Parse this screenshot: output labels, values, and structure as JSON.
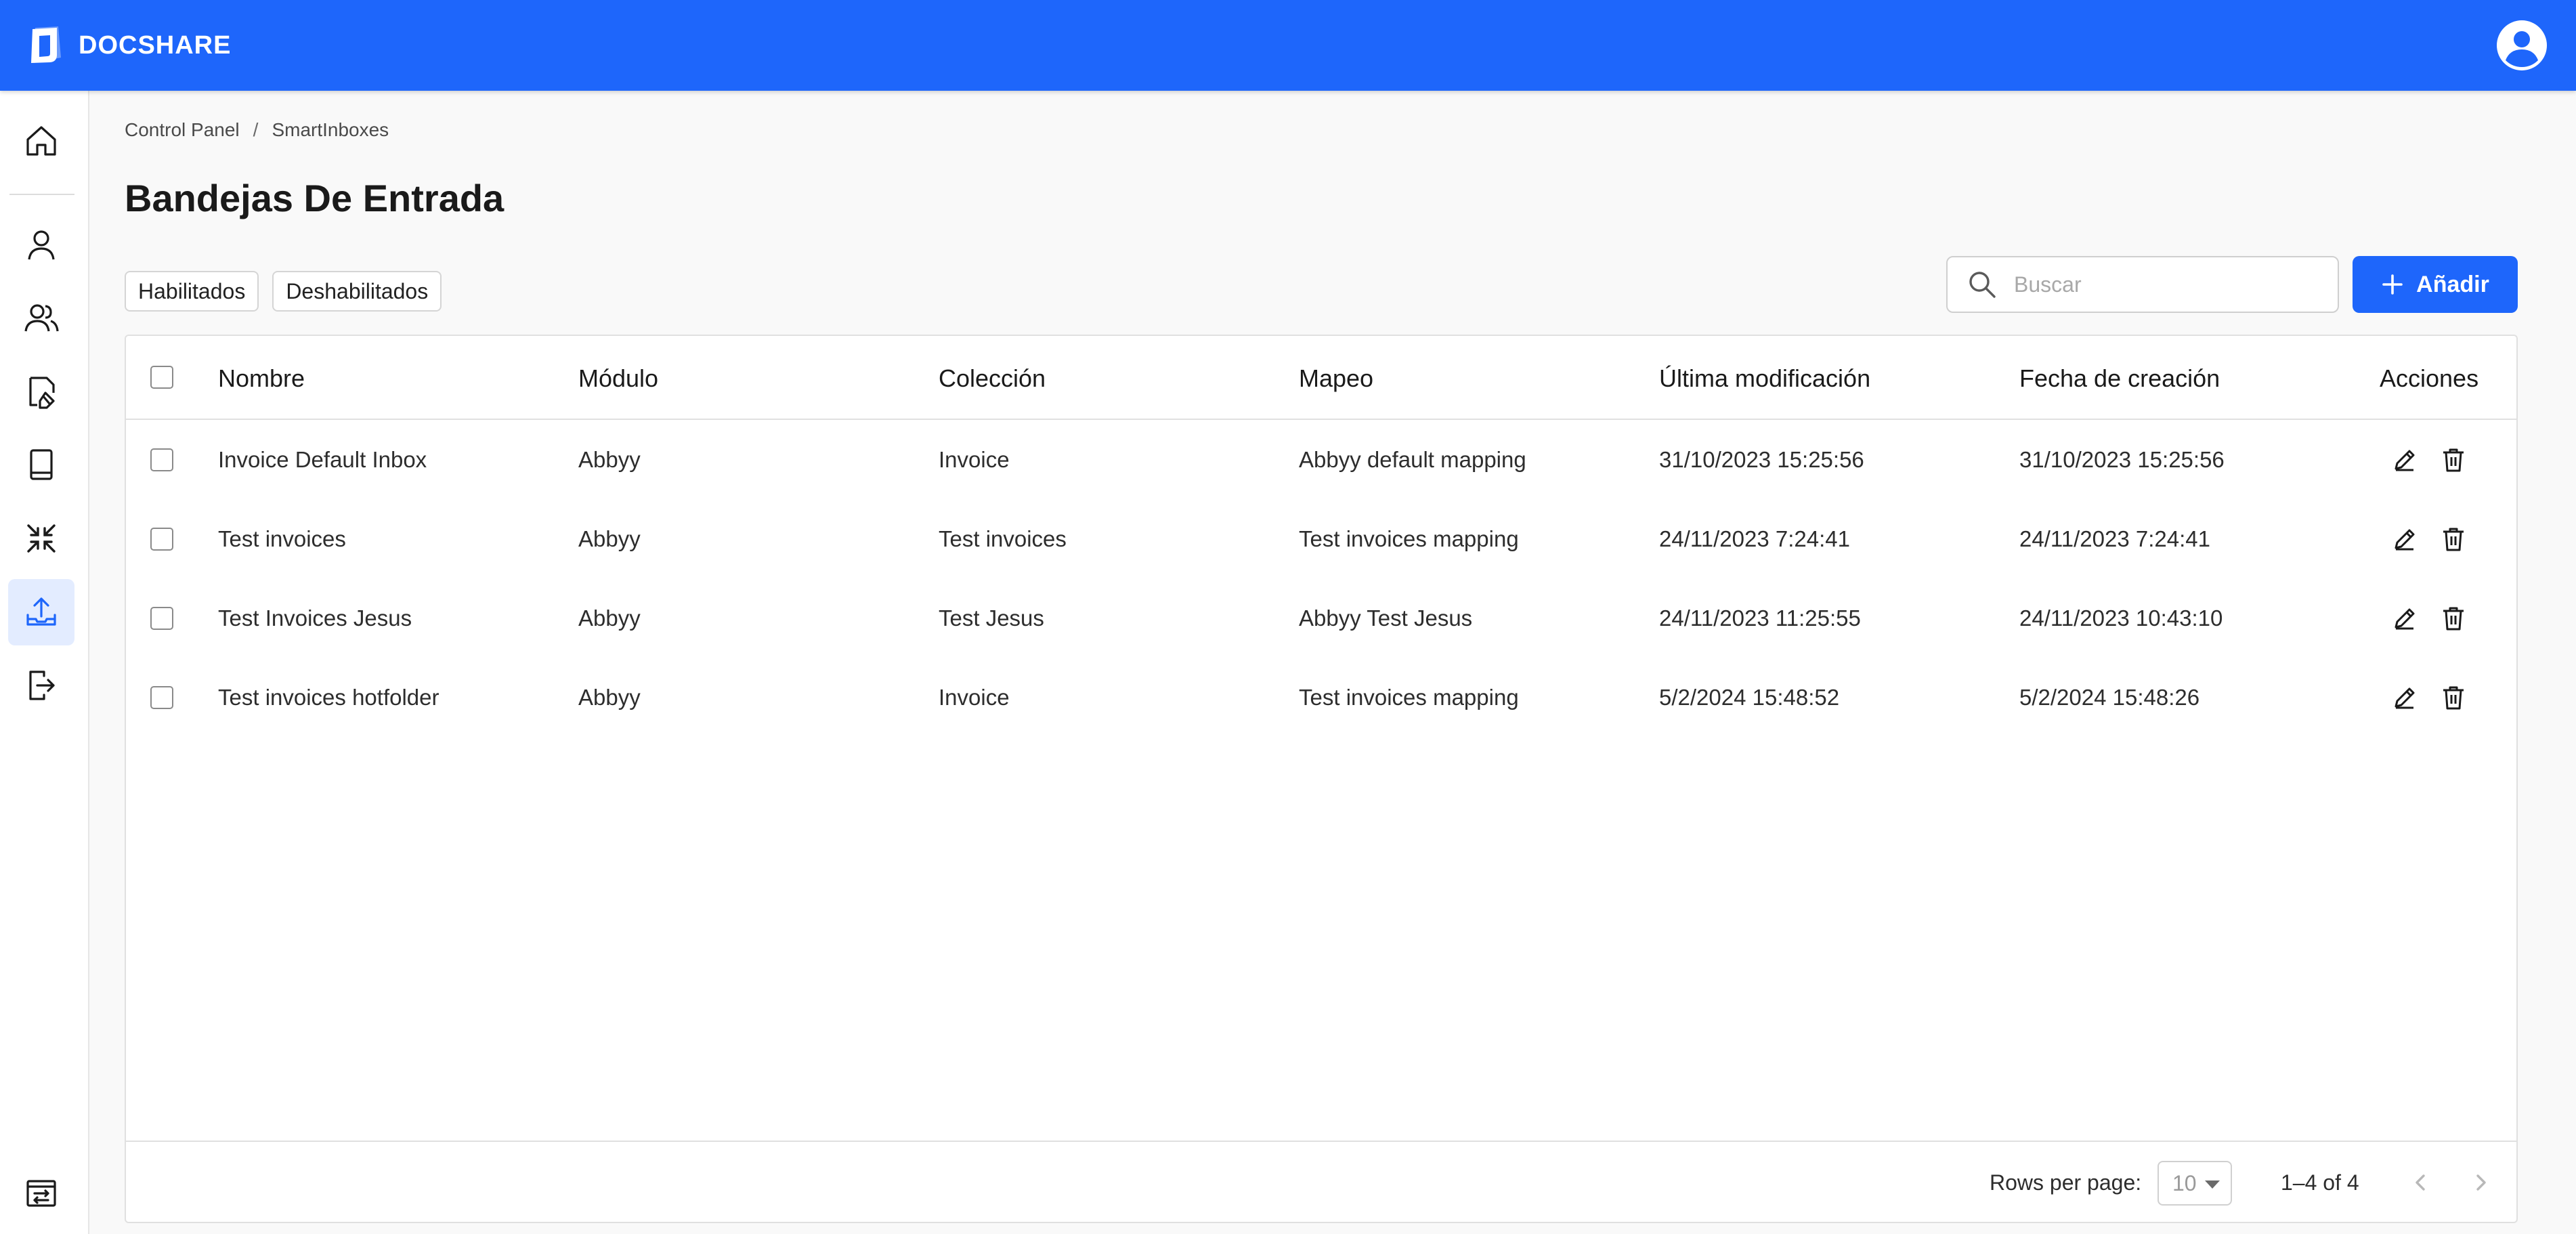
{
  "app": {
    "brand": "DOCSHARE"
  },
  "colors": {
    "primary": "#1e66fb",
    "active_nav_bg": "#e3ecff",
    "background": "#f9f9f9"
  },
  "sidebar": {
    "items": [
      {
        "icon": "home-icon"
      },
      {
        "icon": "user-icon"
      },
      {
        "icon": "users-icon"
      },
      {
        "icon": "document-edit-icon"
      },
      {
        "icon": "book-icon"
      },
      {
        "icon": "compress-icon"
      },
      {
        "icon": "inbox-upload-icon",
        "active": true
      },
      {
        "icon": "exit-icon"
      },
      {
        "icon": "switch-panel-icon"
      }
    ]
  },
  "breadcrumb": {
    "items": [
      "Control Panel",
      "SmartInboxes"
    ],
    "separator": "/"
  },
  "page": {
    "title": "Bandejas De Entrada"
  },
  "filters": {
    "enabled": "Habilitados",
    "disabled": "Deshabilitados"
  },
  "search": {
    "placeholder": "Buscar"
  },
  "toolbar": {
    "add_label": "Añadir"
  },
  "table": {
    "columns": [
      "Nombre",
      "Módulo",
      "Colección",
      "Mapeo",
      "Última modificación",
      "Fecha de creación",
      "Acciones"
    ],
    "rows": [
      [
        "Invoice Default Inbox",
        "Abbyy",
        "Invoice",
        "Abbyy default mapping",
        "31/10/2023 15:25:56",
        "31/10/2023 15:25:56"
      ],
      [
        "Test invoices",
        "Abbyy",
        "Test invoices",
        "Test invoices mapping",
        "24/11/2023 7:24:41",
        "24/11/2023 7:24:41"
      ],
      [
        "Test Invoices Jesus",
        "Abbyy",
        "Test Jesus",
        "Abbyy Test Jesus",
        "24/11/2023 11:25:55",
        "24/11/2023 10:43:10"
      ],
      [
        "Test invoices hotfolder",
        "Abbyy",
        "Invoice",
        "Test invoices mapping",
        "5/2/2024 15:48:52",
        "5/2/2024 15:48:26"
      ]
    ]
  },
  "pagination": {
    "rows_per_page_label": "Rows per page:",
    "rows_per_page": "10",
    "range": "1–4 of 4"
  }
}
